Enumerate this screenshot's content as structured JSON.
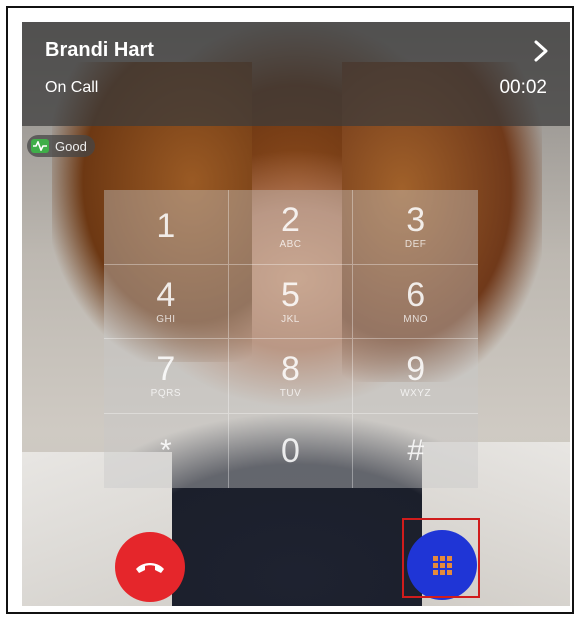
{
  "call": {
    "caller_name": "Brandi Hart",
    "status": "On Call",
    "timer": "00:02",
    "quality": "Good"
  },
  "keypad": {
    "keys": [
      {
        "digit": "1",
        "letters": ""
      },
      {
        "digit": "2",
        "letters": "ABC"
      },
      {
        "digit": "3",
        "letters": "DEF"
      },
      {
        "digit": "4",
        "letters": "GHI"
      },
      {
        "digit": "5",
        "letters": "JKL"
      },
      {
        "digit": "6",
        "letters": "MNO"
      },
      {
        "digit": "7",
        "letters": "PQRS"
      },
      {
        "digit": "8",
        "letters": "TUV"
      },
      {
        "digit": "9",
        "letters": "WXYZ"
      },
      {
        "digit": "*",
        "letters": ""
      },
      {
        "digit": "0",
        "letters": ""
      },
      {
        "digit": "#",
        "letters": ""
      }
    ]
  },
  "colors": {
    "end_call": "#e5262b",
    "keypad_button": "#1f35d6",
    "quality_good": "#3fae49",
    "highlight": "#d01c1c"
  },
  "icons": {
    "chevron": "chevron-right-icon",
    "quality": "waveform-icon",
    "end_call": "hang-up-icon",
    "keypad": "keypad-grid-icon"
  }
}
